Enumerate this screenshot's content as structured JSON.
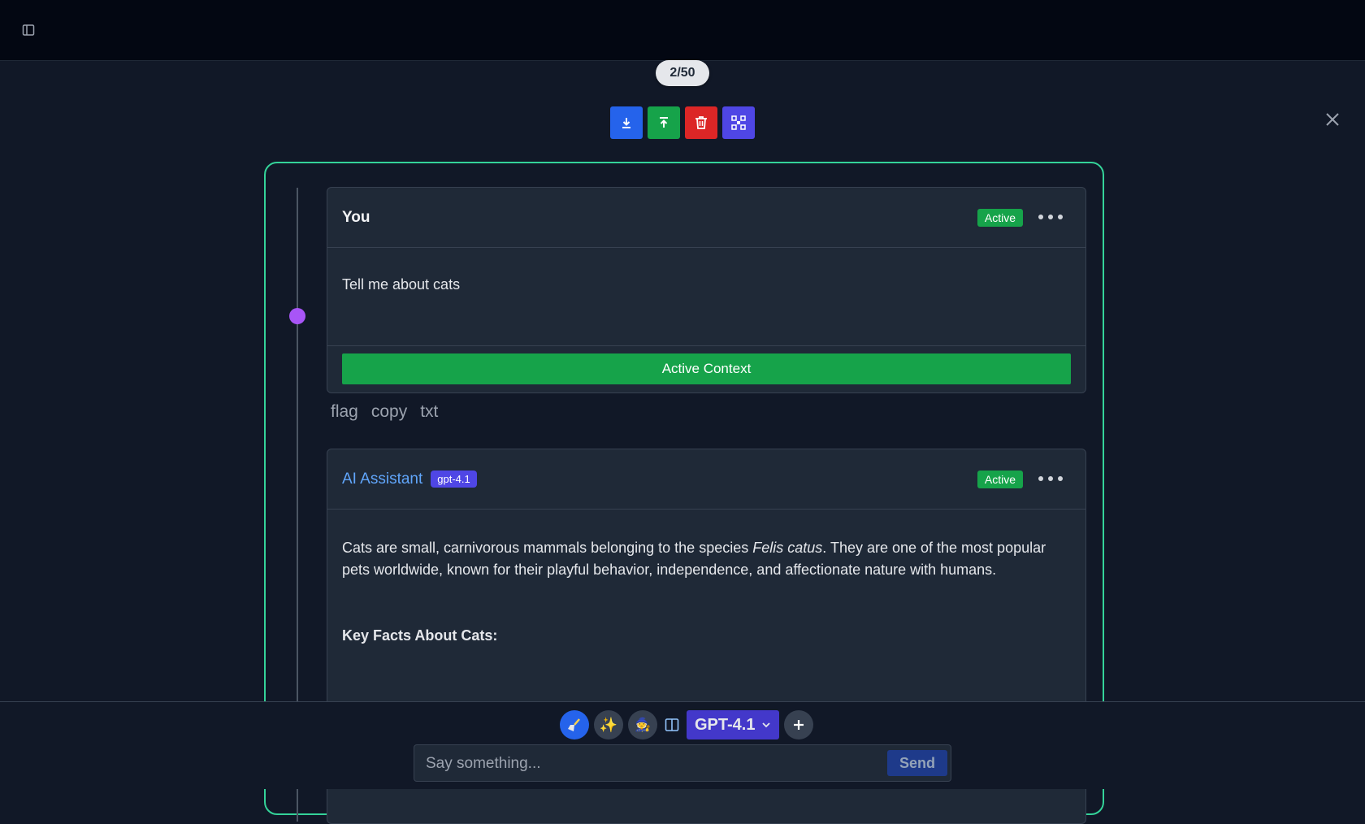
{
  "header": {
    "sidebar_toggle_icon": "sidebar-toggle-icon"
  },
  "counter": {
    "text": "2/50"
  },
  "toolbar": {
    "buttons": [
      {
        "icon": "download-icon",
        "color": "#2563eb"
      },
      {
        "icon": "upload-icon",
        "color": "#16a34a"
      },
      {
        "icon": "trash-icon",
        "color": "#dc2626"
      },
      {
        "icon": "network-icon",
        "color": "#4f46e5"
      }
    ]
  },
  "messages": [
    {
      "author": "You",
      "status": "Active",
      "body": "Tell me about cats",
      "context_button": "Active Context",
      "actions": [
        "flag",
        "copy",
        "txt"
      ]
    },
    {
      "author": "AI Assistant",
      "model": "gpt-4.1",
      "status": "Active",
      "body_pre": "Cats are small, carnivorous mammals belonging to the species ",
      "body_em": "Felis catus",
      "body_post": ". They are one of the most popular pets worldwide, known for their playful behavior, independence, and affectionate nature with humans.",
      "heading": "Key Facts About Cats:"
    }
  ],
  "composer": {
    "icons": [
      "broom-icon",
      "sparkles-icon",
      "wizard-icon",
      "split-view-icon"
    ],
    "model_label": "GPT-4.1",
    "placeholder": "Say something...",
    "send_label": "Send"
  },
  "colors": {
    "panel_border": "#34d399",
    "accent": "#2563eb",
    "active": "#16a34a"
  }
}
